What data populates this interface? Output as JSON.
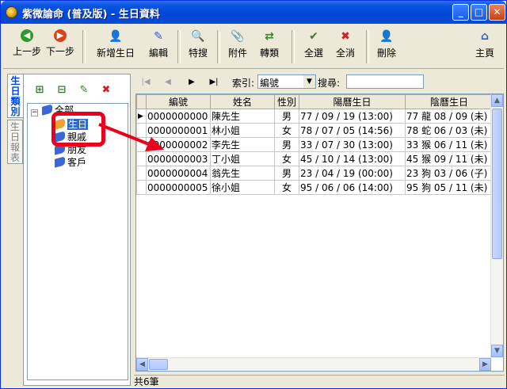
{
  "window": {
    "title": "紫微論命 (普及版) - 生日資料"
  },
  "toolbar": {
    "prev": "上一步",
    "next": "下一步",
    "add_birthday": "新增生日",
    "edit": "編輯",
    "special_search": "特搜",
    "attachment": "附件",
    "transfer": "轉類",
    "select_all": "全選",
    "clear_all": "全消",
    "delete": "刪除",
    "home": "主頁"
  },
  "sidetabs": {
    "categories": "生日類別",
    "report": "生日報表"
  },
  "tree": {
    "root": "全部",
    "items": [
      "生日",
      "親戚",
      "朋友",
      "客戶"
    ]
  },
  "nav": {
    "index_label": "索引:",
    "index_value": "編號",
    "search_label": "搜尋:",
    "search_value": ""
  },
  "grid": {
    "columns": [
      "編號",
      "姓名",
      "性別",
      "陽曆生日",
      "陰曆生日"
    ],
    "rows": [
      [
        "0000000000",
        "陳先生",
        "男",
        "77 / 09 / 19 (13:00)",
        "77 龍 08 / 09 (未)"
      ],
      [
        "0000000001",
        "林小姐",
        "女",
        "78 / 07 / 05 (14:56)",
        "78 蛇 06 / 03 (未)"
      ],
      [
        "0000000002",
        "李先生",
        "男",
        "33 / 07 / 30 (13:00)",
        "33 猴 06 / 11 (未)"
      ],
      [
        "0000000003",
        "丁小姐",
        "女",
        "45 / 10 / 14 (13:00)",
        "45 猴 09 / 11 (未)"
      ],
      [
        "0000000004",
        "翁先生",
        "男",
        "23 / 04 / 19 (00:00)",
        "23 狗 03 / 06 (子)"
      ],
      [
        "0000000005",
        "徐小姐",
        "女",
        "95 / 06 / 06 (14:00)",
        "95 狗 05 / 11 (未)"
      ]
    ]
  },
  "status": {
    "count": "共6筆"
  },
  "colors": {
    "title_bar": "#0a55e0",
    "highlight": "#e8001c",
    "book_orange": "#f0a030",
    "book_blue": "#3a66d8"
  }
}
